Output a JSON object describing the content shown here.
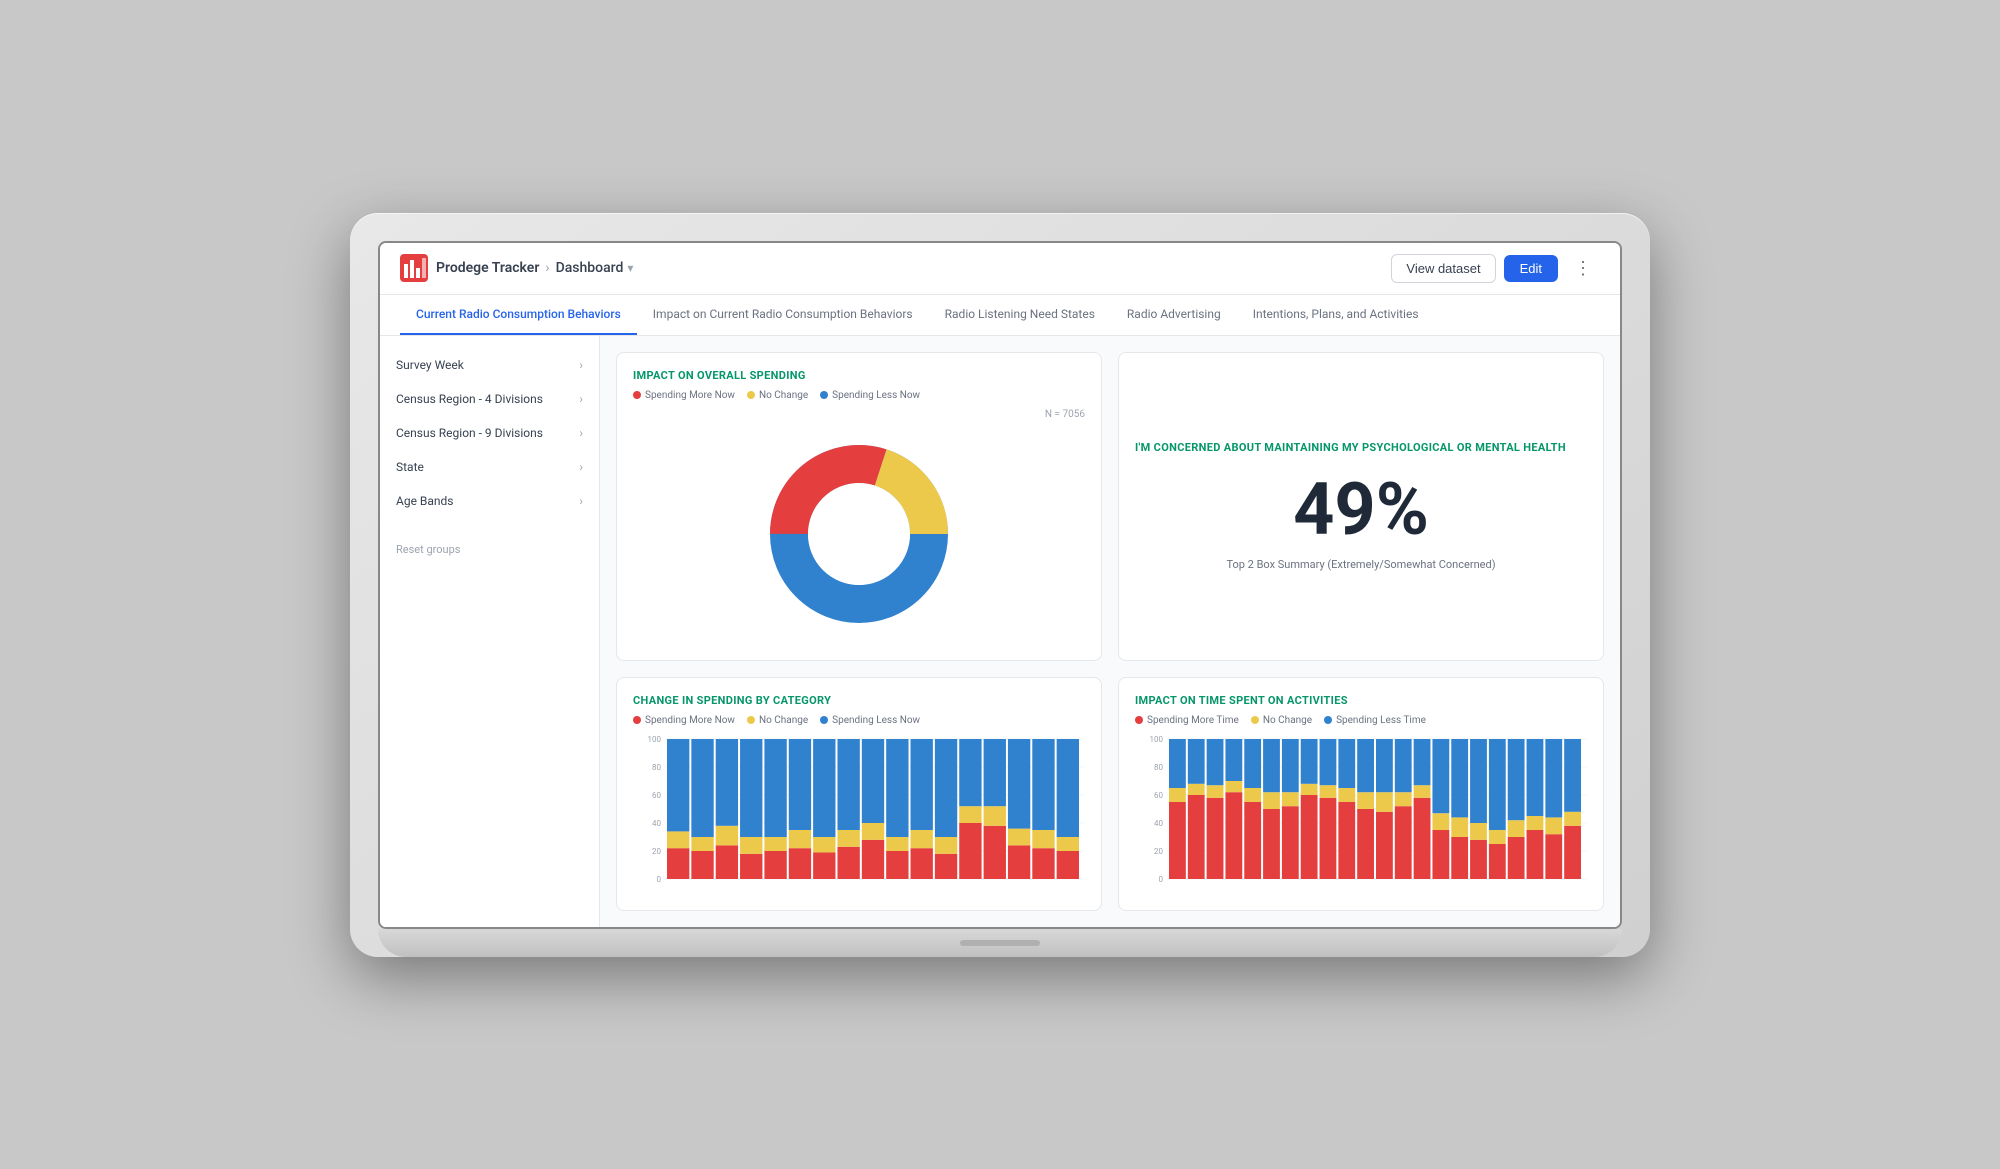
{
  "app": {
    "logo_alt": "Prodege Logo",
    "title": "Prodege Tracker",
    "breadcrumb_sep": "›",
    "breadcrumb_current": "Dashboard",
    "breadcrumb_chevron": "▾",
    "view_dataset_label": "View dataset",
    "edit_label": "Edit",
    "more_icon": "⋮"
  },
  "tabs": [
    {
      "id": "current",
      "label": "Current Radio Consumption Behaviors",
      "active": true
    },
    {
      "id": "impact",
      "label": "Impact on Current Radio Consumption Behaviors",
      "active": false
    },
    {
      "id": "listening",
      "label": "Radio Listening Need States",
      "active": false
    },
    {
      "id": "advertising",
      "label": "Radio Advertising",
      "active": false
    },
    {
      "id": "intentions",
      "label": "Intentions, Plans, and Activities",
      "active": false
    }
  ],
  "sidebar": {
    "items": [
      {
        "id": "survey-week",
        "label": "Survey Week"
      },
      {
        "id": "census-4",
        "label": "Census Region - 4 Divisions"
      },
      {
        "id": "census-9",
        "label": "Census Region - 9 Divisions"
      },
      {
        "id": "state",
        "label": "State"
      },
      {
        "id": "age-bands",
        "label": "Age Bands"
      }
    ],
    "reset_label": "Reset groups"
  },
  "charts": {
    "spending": {
      "title": "IMPACT ON OVERALL SPENDING",
      "n_value": "N = 7056",
      "legend": [
        {
          "label": "Spending More Now",
          "color": "#e53e3e"
        },
        {
          "label": "No Change",
          "color": "#ecc94b"
        },
        {
          "label": "Spending Less Now",
          "color": "#3182ce"
        }
      ],
      "donut": {
        "segments": [
          {
            "label": "Spending More Now",
            "value": 30,
            "color": "#e53e3e"
          },
          {
            "label": "No Change",
            "color": "#ecc94b",
            "value": 20
          },
          {
            "label": "Spending Less Now",
            "color": "#3182ce",
            "value": 50
          }
        ]
      }
    },
    "mental_health": {
      "title": "I'M CONCERNED ABOUT MAINTAINING MY PSYCHOLOGICAL OR MENTAL HEALTH",
      "percent": "49%",
      "subtitle": "Top 2 Box Summary (Extremely/Somewhat Concerned)"
    },
    "spending_category": {
      "title": "CHANGE IN SPENDING BY CATEGORY",
      "legend": [
        {
          "label": "Spending More Now",
          "color": "#e53e3e"
        },
        {
          "label": "No Change",
          "color": "#ecc94b"
        },
        {
          "label": "Spending Less Now",
          "color": "#3182ce"
        }
      ],
      "bars": [
        {
          "red": 22,
          "yellow": 12,
          "blue": 66
        },
        {
          "red": 20,
          "yellow": 10,
          "blue": 70
        },
        {
          "red": 24,
          "yellow": 14,
          "blue": 62
        },
        {
          "red": 18,
          "yellow": 12,
          "blue": 70
        },
        {
          "red": 20,
          "yellow": 10,
          "blue": 70
        },
        {
          "red": 22,
          "yellow": 13,
          "blue": 65
        },
        {
          "red": 19,
          "yellow": 11,
          "blue": 70
        },
        {
          "red": 23,
          "yellow": 12,
          "blue": 65
        },
        {
          "red": 28,
          "yellow": 12,
          "blue": 60
        },
        {
          "red": 20,
          "yellow": 10,
          "blue": 70
        },
        {
          "red": 22,
          "yellow": 13,
          "blue": 65
        },
        {
          "red": 18,
          "yellow": 12,
          "blue": 70
        },
        {
          "red": 40,
          "yellow": 12,
          "blue": 48
        },
        {
          "red": 38,
          "yellow": 14,
          "blue": 48
        },
        {
          "red": 24,
          "yellow": 12,
          "blue": 64
        },
        {
          "red": 22,
          "yellow": 13,
          "blue": 65
        },
        {
          "red": 20,
          "yellow": 10,
          "blue": 70
        }
      ]
    },
    "time_activities": {
      "title": "IMPACT ON TIME SPENT ON ACTIVITIES",
      "legend": [
        {
          "label": "Spending More Time",
          "color": "#e53e3e"
        },
        {
          "label": "No Change",
          "color": "#ecc94b"
        },
        {
          "label": "Spending Less Time",
          "color": "#3182ce"
        }
      ],
      "bars": [
        {
          "red": 55,
          "yellow": 10,
          "blue": 35
        },
        {
          "red": 60,
          "yellow": 8,
          "blue": 32
        },
        {
          "red": 58,
          "yellow": 9,
          "blue": 33
        },
        {
          "red": 62,
          "yellow": 8,
          "blue": 30
        },
        {
          "red": 55,
          "yellow": 10,
          "blue": 35
        },
        {
          "red": 50,
          "yellow": 12,
          "blue": 38
        },
        {
          "red": 52,
          "yellow": 10,
          "blue": 38
        },
        {
          "red": 60,
          "yellow": 8,
          "blue": 32
        },
        {
          "red": 58,
          "yellow": 9,
          "blue": 33
        },
        {
          "red": 55,
          "yellow": 10,
          "blue": 35
        },
        {
          "red": 50,
          "yellow": 12,
          "blue": 38
        },
        {
          "red": 48,
          "yellow": 14,
          "blue": 38
        },
        {
          "red": 52,
          "yellow": 10,
          "blue": 38
        },
        {
          "red": 58,
          "yellow": 9,
          "blue": 33
        },
        {
          "red": 35,
          "yellow": 12,
          "blue": 53
        },
        {
          "red": 30,
          "yellow": 14,
          "blue": 56
        },
        {
          "red": 28,
          "yellow": 12,
          "blue": 60
        },
        {
          "red": 25,
          "yellow": 10,
          "blue": 65
        },
        {
          "red": 30,
          "yellow": 12,
          "blue": 58
        },
        {
          "red": 35,
          "yellow": 10,
          "blue": 55
        },
        {
          "red": 32,
          "yellow": 12,
          "blue": 56
        },
        {
          "red": 38,
          "yellow": 10,
          "blue": 52
        }
      ]
    }
  }
}
